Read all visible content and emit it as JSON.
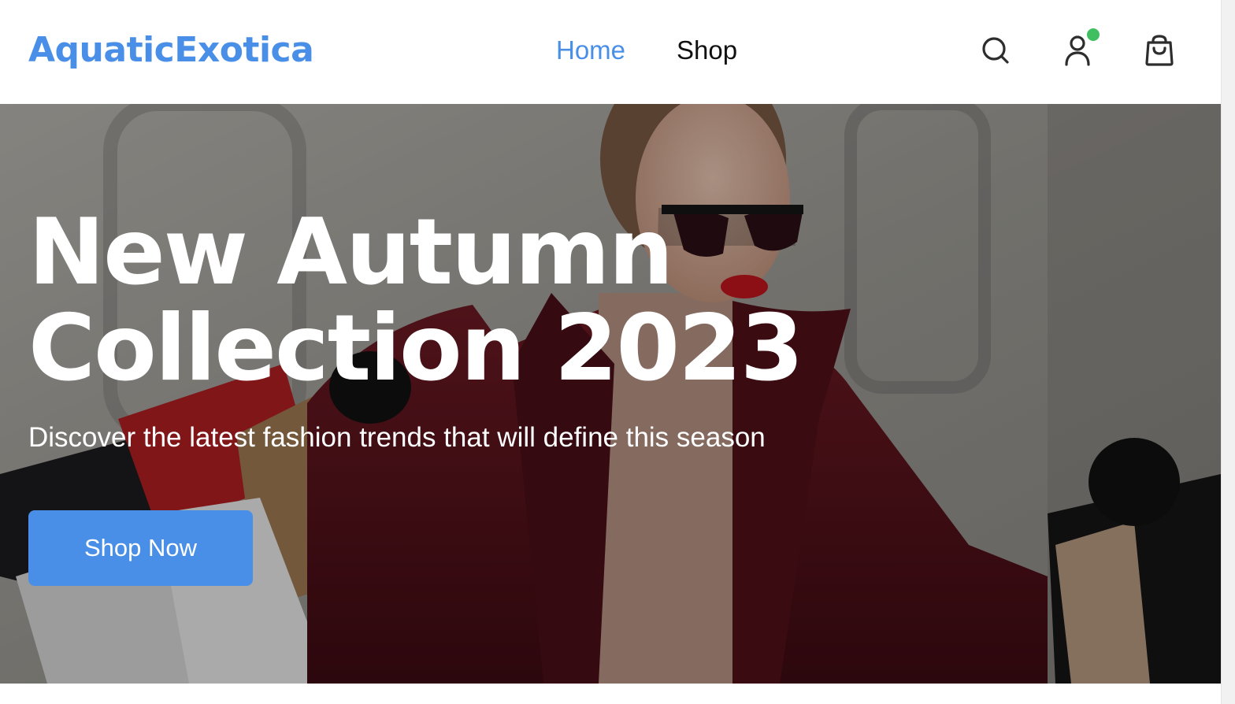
{
  "header": {
    "logo": "AquaticExotica",
    "nav": [
      {
        "label": "Home",
        "active": true
      },
      {
        "label": "Shop",
        "active": false
      }
    ],
    "icons": [
      "search-icon",
      "user-icon",
      "shopping-bag-icon"
    ],
    "user_status_color": "#3fbf5f"
  },
  "hero": {
    "title_line_1": "New Autumn",
    "title_line_2": "Collection 2023",
    "subtitle": "Discover the latest fashion trends that will define this season",
    "cta_label": "Shop Now"
  },
  "colors": {
    "brand": "#4a8fe7",
    "nav_inactive": "#111111",
    "hero_text": "#ffffff"
  }
}
